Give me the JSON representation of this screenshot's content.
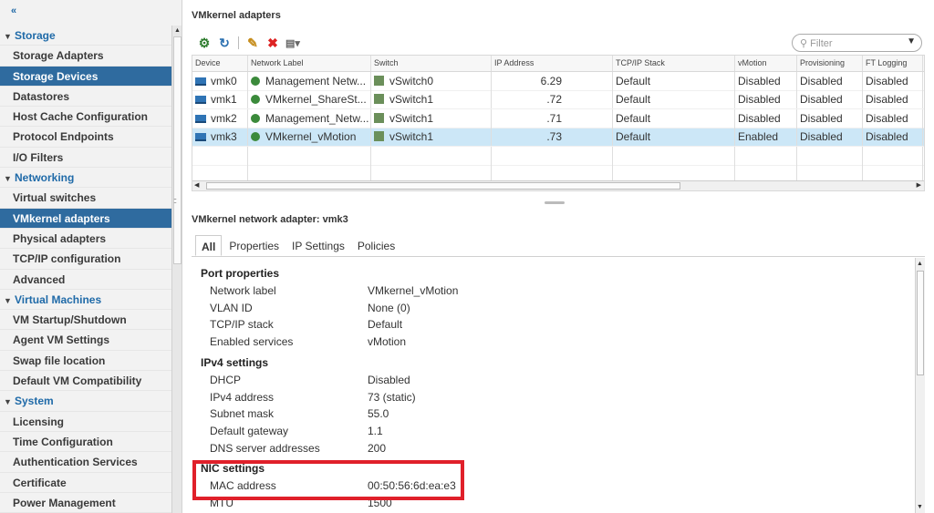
{
  "sidebar": {
    "collapse_icon": "«",
    "items": [
      {
        "label": "Storage",
        "group": true
      },
      {
        "label": "Storage Adapters"
      },
      {
        "label": "Storage Devices",
        "selected": true
      },
      {
        "label": "Datastores"
      },
      {
        "label": "Host Cache Configuration"
      },
      {
        "label": "Protocol Endpoints"
      },
      {
        "label": "I/O Filters"
      },
      {
        "label": "Networking",
        "group": true
      },
      {
        "label": "Virtual switches"
      },
      {
        "label": "VMkernel adapters",
        "selected": true
      },
      {
        "label": "Physical adapters"
      },
      {
        "label": "TCP/IP configuration"
      },
      {
        "label": "Advanced"
      },
      {
        "label": "Virtual Machines",
        "group": true
      },
      {
        "label": "VM Startup/Shutdown"
      },
      {
        "label": "Agent VM Settings"
      },
      {
        "label": "Swap file location"
      },
      {
        "label": "Default VM Compatibility"
      },
      {
        "label": "System",
        "group": true
      },
      {
        "label": "Licensing"
      },
      {
        "label": "Time Configuration"
      },
      {
        "label": "Authentication Services"
      },
      {
        "label": "Certificate"
      },
      {
        "label": "Power Management"
      }
    ]
  },
  "main": {
    "title": "VMkernel adapters",
    "filter_placeholder": "Filter",
    "columns": [
      "Device",
      "Network Label",
      "Switch",
      "IP Address",
      "TCP/IP Stack",
      "vMotion",
      "Provisioning",
      "FT Logging"
    ],
    "rows": [
      {
        "device": "vmk0",
        "label": "Management Netw...",
        "switch": "vSwitch0",
        "ip": "6.29",
        "stack": "Default",
        "vmotion": "Disabled",
        "prov": "Disabled",
        "ft": "Disabled"
      },
      {
        "device": "vmk1",
        "label": "VMkernel_ShareSt...",
        "switch": "vSwitch1",
        "ip": ".72",
        "stack": "Default",
        "vmotion": "Disabled",
        "prov": "Disabled",
        "ft": "Disabled"
      },
      {
        "device": "vmk2",
        "label": "Management_Netw...",
        "switch": "vSwitch1",
        "ip": ".71",
        "stack": "Default",
        "vmotion": "Disabled",
        "prov": "Disabled",
        "ft": "Disabled"
      },
      {
        "device": "vmk3",
        "label": "VMkernel_vMotion",
        "switch": "vSwitch1",
        "ip": ".73",
        "stack": "Default",
        "vmotion": "Enabled",
        "prov": "Disabled",
        "ft": "Disabled",
        "selected": true
      }
    ],
    "detail_title": "VMkernel network adapter: vmk3",
    "tabs": [
      "All",
      "Properties",
      "IP Settings",
      "Policies"
    ],
    "sections": {
      "port": {
        "title": "Port properties",
        "rows": [
          [
            "Network label",
            "VMkernel_vMotion"
          ],
          [
            "VLAN ID",
            "None (0)"
          ],
          [
            "TCP/IP stack",
            "Default"
          ],
          [
            "Enabled services",
            "vMotion"
          ]
        ]
      },
      "ipv4": {
        "title": "IPv4 settings",
        "rows": [
          [
            "DHCP",
            "Disabled"
          ],
          [
            "IPv4 address",
            "73 (static)"
          ],
          [
            "Subnet mask",
            "55.0"
          ],
          [
            "Default gateway",
            "1.1"
          ],
          [
            "DNS server addresses",
            "200"
          ]
        ]
      },
      "nic": {
        "title": "NIC settings",
        "rows": [
          [
            "MAC address",
            "00:50:56:6d:ea:e3"
          ],
          [
            "MTU",
            "1500"
          ]
        ]
      }
    }
  }
}
